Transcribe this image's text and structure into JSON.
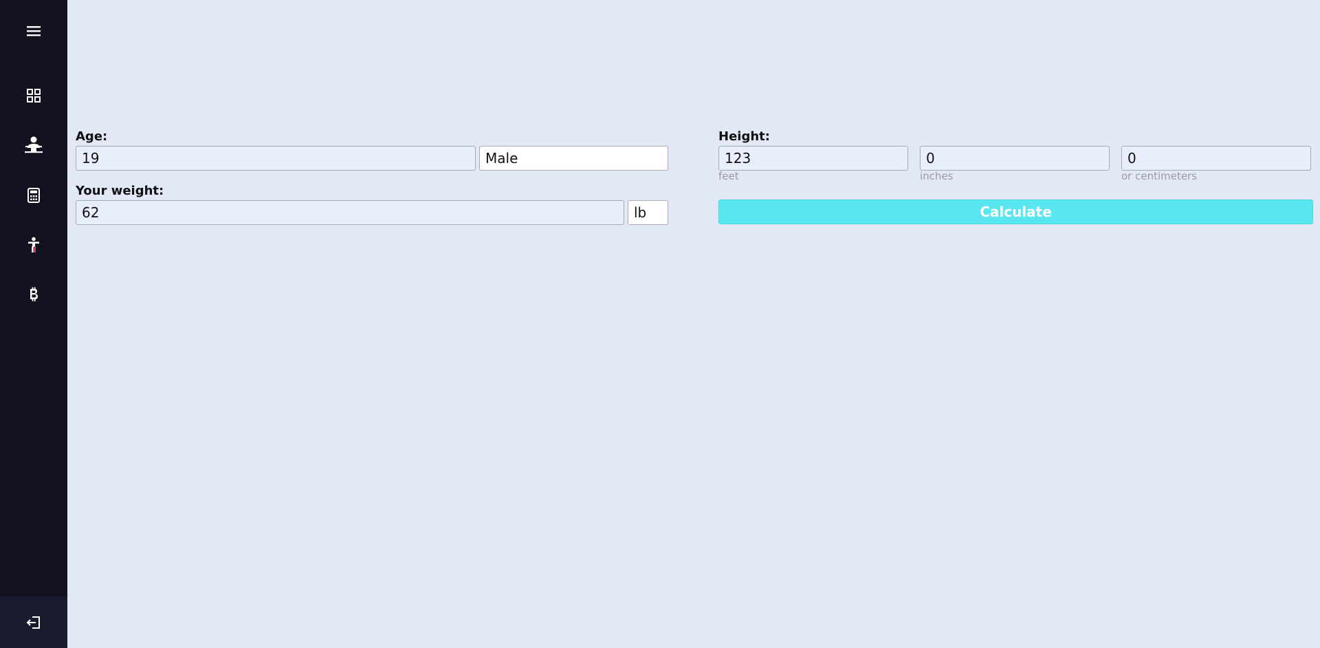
{
  "sidebar": {
    "items": [
      {
        "icon": "hamburger-menu-icon"
      },
      {
        "icon": "dashboard-grid-icon"
      },
      {
        "icon": "doctor-icon"
      },
      {
        "icon": "calculator-icon"
      },
      {
        "icon": "person-icon"
      },
      {
        "icon": "bitcoin-icon"
      }
    ],
    "logout_icon": "logout-icon"
  },
  "form": {
    "age_label": "Age:",
    "age_value": "19",
    "gender_value": "Male",
    "weight_label": "Your weight:",
    "weight_value": "62",
    "weight_unit": "lb",
    "height_label": "Height:",
    "feet_value": "123",
    "feet_hint": "feet",
    "inches_value": "0",
    "inches_hint": "inches",
    "cm_value": "0",
    "cm_hint": "or centimeters",
    "calculate_label": "Calculate"
  },
  "colors": {
    "sidebar_bg": "#121221",
    "page_bg": "#e3e8f6",
    "accent": "#5ae6ee"
  }
}
